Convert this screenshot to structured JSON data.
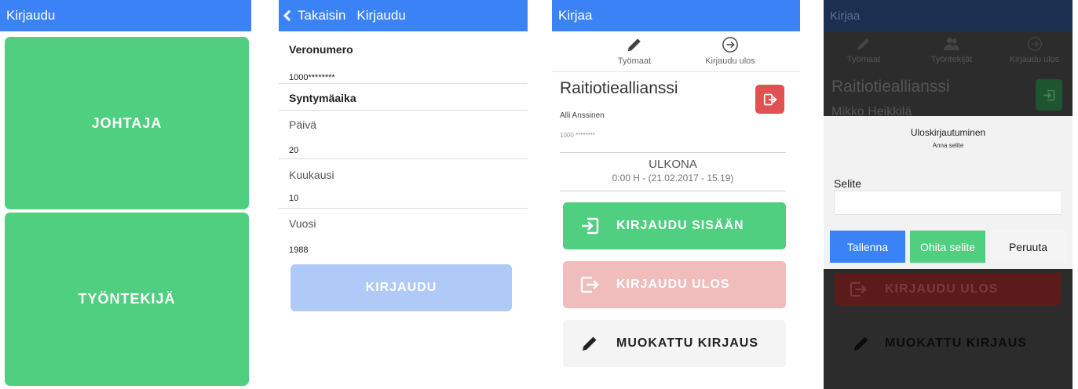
{
  "colors": {
    "appbar": "#3b82f6",
    "green": "#4fcf7f",
    "red": "#e05151",
    "pale_blue": "#afcaf6",
    "pale_red": "#f0bcbc",
    "light_gray": "#f4f4f4"
  },
  "screen1": {
    "title": "Kirjaudu",
    "role_manager": "JOHTAJA",
    "role_employee": "TYÖNTEKIJÄ"
  },
  "screen2": {
    "back_label": "Takaisin",
    "title": "Kirjaudu",
    "tax_number_label": "Veronumero",
    "tax_number_value": "1000********",
    "birthdate_label": "Syntymäaika",
    "day_label": "Päivä",
    "day_value": "20",
    "month_label": "Kuukausi",
    "month_value": "10",
    "year_label": "Vuosi",
    "year_value": "1988",
    "login_button": "KIRJAUDU"
  },
  "screen3": {
    "title": "Kirjaa",
    "nav": {
      "sites": "Työmaat",
      "logout": "Kirjaudu ulos"
    },
    "company": "Raitiotieallianssi",
    "person": "Alli Anssinen",
    "person_id": "1000 ********",
    "status": "ULKONA",
    "status_detail": "0:00 H - (21.02.2017 - 15.19)",
    "btn_checkin": "KIRJAUDU SISÄÄN",
    "btn_checkout": "KIRJAUDU ULOS",
    "btn_custom": "MUOKATTU KIRJAUS"
  },
  "screen4": {
    "title": "Kirjaa",
    "nav": {
      "sites": "Työmaat",
      "workers": "Työntekijät",
      "logout": "Kirjaudu ulos"
    },
    "company": "Raitiotieallianssi",
    "person": "Mikko Heikkilä",
    "dialog_title": "Uloskirjautuminen",
    "dialog_subtitle": "Anna selite",
    "field_label": "Selite",
    "field_value": "",
    "btn_save": "Tallenna",
    "btn_skip": "Ohita selite",
    "btn_cancel": "Peruuta",
    "btn_checkout": "KIRJAUDU ULOS",
    "btn_custom": "MUOKATTU KIRJAUS"
  }
}
